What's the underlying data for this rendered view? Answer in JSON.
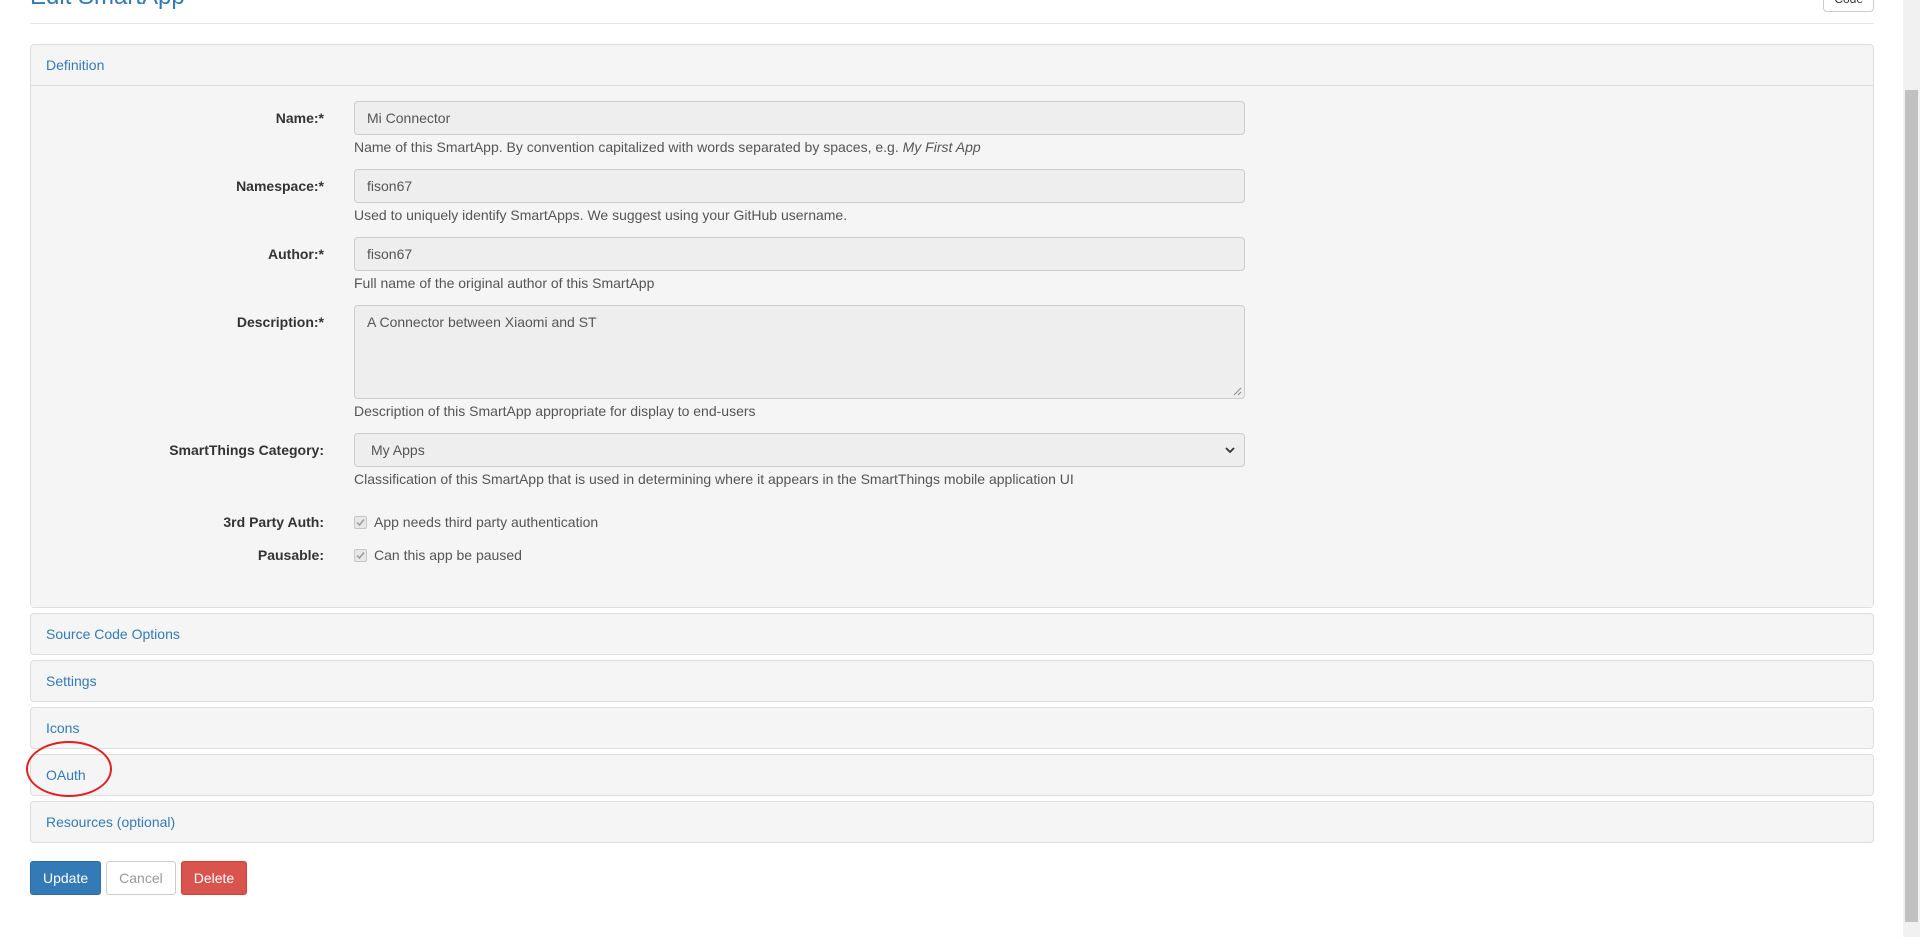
{
  "header": {
    "title": "Edit SmartApp",
    "right_button": "Code"
  },
  "panels": {
    "definition": "Definition",
    "source_code_options": "Source Code Options",
    "settings": "Settings",
    "icons": "Icons",
    "oauth": "OAuth",
    "resources": "Resources (optional)"
  },
  "form": {
    "name": {
      "label": "Name:*",
      "value": "Mi Connector",
      "help": "Name of this SmartApp. By convention capitalized with words separated by spaces, e.g.",
      "help_example": "My First App"
    },
    "namespace": {
      "label": "Namespace:*",
      "value": "fison67",
      "help": "Used to uniquely identify SmartApps. We suggest using your GitHub username."
    },
    "author": {
      "label": "Author:*",
      "value": "fison67",
      "help": "Full name of the original author of this SmartApp"
    },
    "description": {
      "label": "Description:*",
      "value": "A Connector between Xiaomi and ST",
      "help": "Description of this SmartApp appropriate for display to end-users"
    },
    "category": {
      "label": "SmartThings Category:",
      "selected": "My Apps",
      "help": "Classification of this SmartApp that is used in determining where it appears in the SmartThings mobile application UI"
    },
    "third_party_auth": {
      "label": "3rd Party Auth:",
      "checkbox_label": "App needs third party authentication",
      "checked": true
    },
    "pausable": {
      "label": "Pausable:",
      "checkbox_label": "Can this app be paused",
      "checked": true
    }
  },
  "actions": {
    "update": "Update",
    "cancel": "Cancel",
    "delete": "Delete"
  },
  "colors": {
    "link": "#337ab7",
    "primary": "#337ab7",
    "danger": "#d9534f",
    "annotation": "#e02020"
  }
}
